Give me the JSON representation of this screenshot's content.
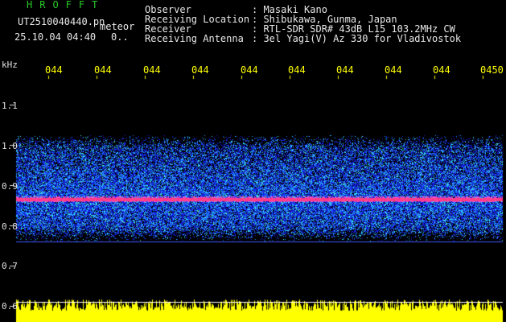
{
  "app": {
    "title": "HROFFT"
  },
  "file": {
    "name": "UT2510040440.pn",
    "tag": "meteor",
    "date_time": "25.10.04 04:40",
    "count": "0.."
  },
  "station": {
    "rows": [
      {
        "label": "Observer",
        "value": "Masaki Kano"
      },
      {
        "label": "Receiving Location",
        "value": "Shibukawa, Gunma, Japan"
      },
      {
        "label": "Receiver",
        "value": "RTL-SDR SDR# 43dB L15 103.2MHz CW"
      },
      {
        "label": "Receiving Antenna",
        "value": "3el Yagi(V) Az 330 for Vladivostok"
      }
    ]
  },
  "chart_data": {
    "type": "heatmap",
    "ylabel": "kHz",
    "y_ticks": [
      "1.1",
      "1.0",
      "0.9",
      "0.8",
      "0.7",
      "0.6"
    ],
    "x_ticks": [
      "044",
      "044",
      "044",
      "044",
      "044",
      "044",
      "044",
      "044",
      "044",
      "0450"
    ],
    "carrier_khz": 0.865,
    "band_khz": [
      0.76,
      1.01
    ],
    "colors": {
      "background": "#000000",
      "noise_low": "#1e2aff",
      "noise_high": "#3cc0ff",
      "carrier": "#ff2a8a",
      "amplitude": "#ffff00"
    }
  }
}
